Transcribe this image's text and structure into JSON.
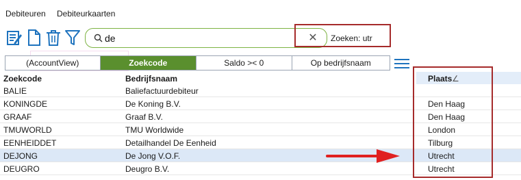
{
  "menu": {
    "items": [
      "Debiteuren",
      "Debiteurkaarten"
    ]
  },
  "toolbar": {
    "icons": [
      "edit-list-icon",
      "new-document-icon",
      "trash-icon",
      "filter-icon"
    ]
  },
  "search": {
    "value": "de",
    "placeholder": "",
    "clear_label": "✕",
    "status": "Zoeken: utr"
  },
  "filters": {
    "segments": [
      "(AccountView)",
      "Zoekcode",
      "Saldo >< 0",
      "Op bedrijfsnaam"
    ],
    "active_index": 1
  },
  "grid": {
    "columns": [
      "Zoekcode",
      "Bedrijfsnaam",
      "Plaats"
    ],
    "sort_indicator": "∠",
    "rows": [
      {
        "zoekcode": "BALIE",
        "bedrijfsnaam": "Baliefactuurdebiteur",
        "plaats": ""
      },
      {
        "zoekcode": "KONINGDE",
        "bedrijfsnaam": "De Koning B.V.",
        "plaats": "Den Haag"
      },
      {
        "zoekcode": "GRAAF",
        "bedrijfsnaam": "Graaf B.V.",
        "plaats": "Den Haag"
      },
      {
        "zoekcode": "TMUWORLD",
        "bedrijfsnaam": "TMU Worldwide",
        "plaats": "London"
      },
      {
        "zoekcode": "EENHEIDDET",
        "bedrijfsnaam": "Detailhandel De Eenheid",
        "plaats": "Tilburg"
      },
      {
        "zoekcode": "DEJONG",
        "bedrijfsnaam": "De Jong V.O.F.",
        "plaats": "Utrecht"
      },
      {
        "zoekcode": "DEUGRO",
        "bedrijfsnaam": "Deugro B.V.",
        "plaats": "Utrecht"
      }
    ],
    "selected_index": 5
  },
  "colors": {
    "accent_green": "#5a8f2e",
    "search_border": "#7cb342",
    "annotation_red": "#a52a2a",
    "arrow_red": "#e02020",
    "selection": "#dce8f7",
    "icon_blue": "#1e73be"
  }
}
